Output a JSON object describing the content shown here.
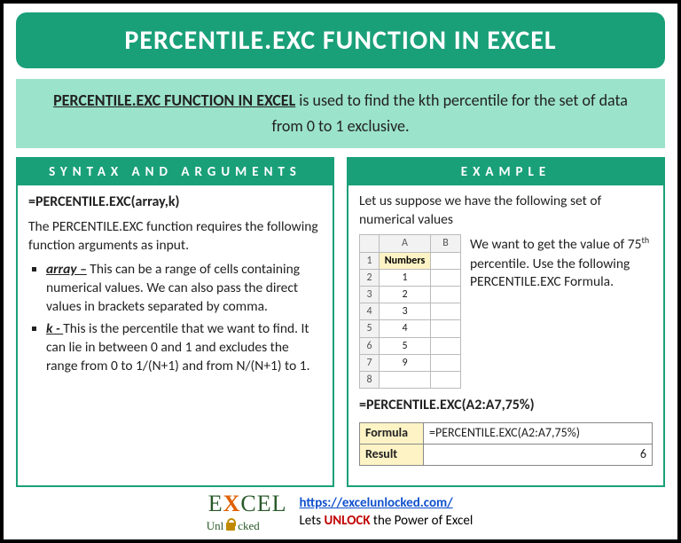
{
  "title": "PERCENTILE.EXC FUNCTION IN EXCEL",
  "intro": {
    "bold": "PERCENTILE.EXC FUNCTION IN EXCEL",
    "rest": " is used to find the kth percentile for the set of data from 0 to 1 exclusive."
  },
  "syntax": {
    "header": "SYNTAX AND ARGUMENTS",
    "formula": "=PERCENTILE.EXC(array,k)",
    "lead": "The PERCENTILE.EXC function requires the following function arguments as input.",
    "args": [
      {
        "name": "array –",
        "desc": " This can be a range of cells containing numerical values. We can also pass the direct values in brackets separated by comma."
      },
      {
        "name": "k - ",
        "desc": " This is the percentile that we want to find. It can lie in between 0 and 1 and excludes the range from 0 to 1/(N+1) and from N/(N+1) to 1."
      }
    ]
  },
  "example": {
    "header": "EXAMPLE",
    "lead": "Let us suppose we have the following set of numerical values",
    "sheet": {
      "col_header": "Numbers",
      "rows": [
        "1",
        "2",
        "3",
        "4",
        "5",
        "9"
      ]
    },
    "want_pre": "We want to get the value of 75",
    "want_sup": "th",
    "want_post": " percentile. Use the following PERCENTILE.EXC Formula.",
    "formula": "=PERCENTILE.EXC(A2:A7,75%)",
    "result_table": {
      "formula_label": "Formula",
      "formula_value": "=PERCENTILE.EXC(A2:A7,75%)",
      "result_label": "Result",
      "result_value": "6"
    }
  },
  "footer": {
    "logo_main_1": "E",
    "logo_main_x": "X",
    "logo_main_2": "CEL",
    "logo_sub": "Unlocked",
    "url": "https://excelunlocked.com/",
    "tagline_pre": "Lets ",
    "tagline_unlock": "UNLOCK",
    "tagline_post": " the Power of Excel"
  },
  "chart_data": {
    "type": "table",
    "title": "Numbers",
    "values": [
      1,
      2,
      3,
      4,
      5,
      9
    ],
    "formula": "=PERCENTILE.EXC(A2:A7,75%)",
    "result": 6
  }
}
